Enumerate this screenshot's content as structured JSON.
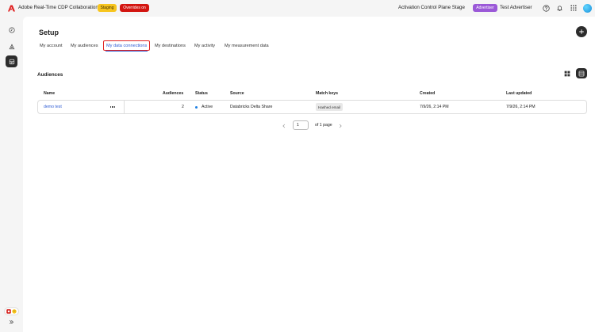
{
  "header": {
    "app_title": "Adobe Real-Time CDP Collaboration",
    "staging_badge": "Staging",
    "overrides_badge": "Overrides on",
    "environment": "Activation Control Plane Stage",
    "role_badge": "Advertiser",
    "user_name": "Test Advertiser",
    "icons": [
      "help-icon",
      "notifications-icon",
      "app-switcher-icon",
      "avatar"
    ],
    "colors": {
      "staging": "#f7c51e",
      "overrides": "#d31510",
      "role": "#9b59d8",
      "logo": "#e02020"
    }
  },
  "rail": {
    "items": [
      "activity-icon",
      "audiences-icon",
      "data-connections-icon"
    ],
    "active": 2,
    "expand_icon": "chevron-double-right-icon"
  },
  "page": {
    "title": "Setup",
    "tabs": [
      {
        "label": "My account"
      },
      {
        "label": "My audiences"
      },
      {
        "label": "My data connections"
      },
      {
        "label": "My destinations"
      },
      {
        "label": "My activity"
      },
      {
        "label": "My measurement data"
      }
    ],
    "active_tab": 2
  },
  "section": {
    "title": "Audiences"
  },
  "table": {
    "columns": [
      "Name",
      "Audiences",
      "Status",
      "Source",
      "Match keys",
      "Created",
      "Last updated"
    ],
    "rows": [
      {
        "name": "demo test",
        "audiences": "2",
        "status": "Active",
        "source": "Databricks Delta Share",
        "match_keys": "Hashed email",
        "created": "7/9/26, 2:14 PM",
        "last_updated": "7/9/26, 2:14 PM"
      }
    ],
    "status_color": "#1b7fe3"
  },
  "pagination": {
    "current_page": "1",
    "of_label": "of 1 page"
  }
}
